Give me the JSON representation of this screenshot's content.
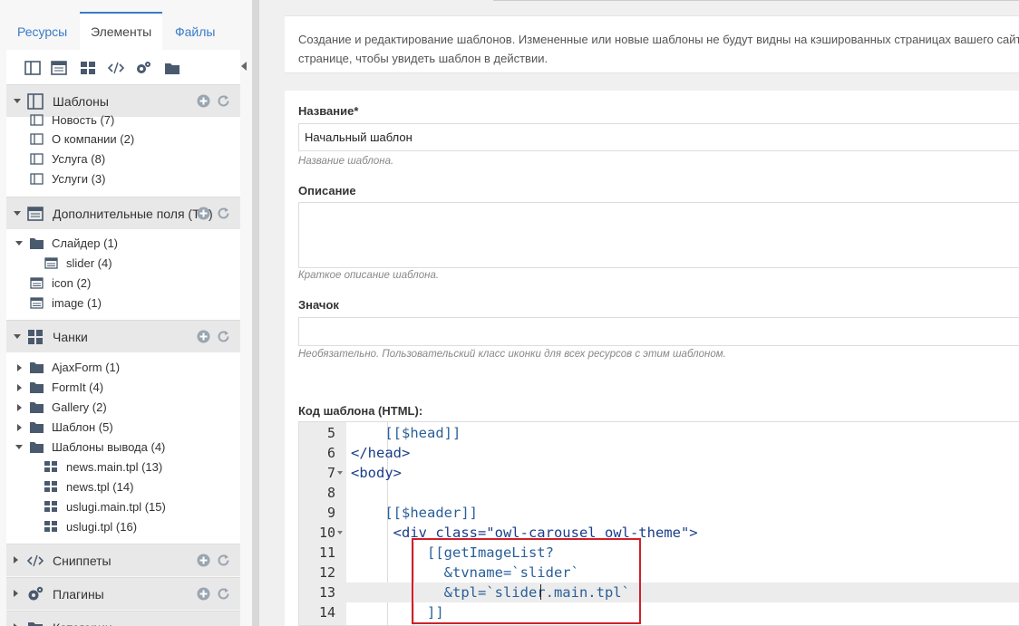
{
  "left_panel": {
    "tabs": [
      {
        "label": "Ресурсы",
        "active": false
      },
      {
        "label": "Элементы",
        "active": true
      },
      {
        "label": "Файлы",
        "active": false
      }
    ],
    "toolbar_icons": [
      "templates-icon",
      "tvs-icon",
      "chunks-icon",
      "snippets-icon",
      "plugins-icon",
      "categories-icon"
    ],
    "sections": {
      "templates": {
        "title": "Шаблоны"
      },
      "tvs": {
        "title": "Дополнительные поля (TV)"
      },
      "chunks": {
        "title": "Чанки"
      },
      "snippets": {
        "title": "Сниппеты"
      },
      "plugins": {
        "title": "Плагины"
      },
      "categories": {
        "title": "Категории"
      }
    },
    "template_items": [
      {
        "label": "Новость (7)"
      },
      {
        "label": "О компании (2)"
      },
      {
        "label": "Услуга (8)"
      },
      {
        "label": "Услуги (3)"
      }
    ],
    "tv_items": [
      {
        "label": "Слайдер (1)"
      },
      {
        "label": "slider (4)"
      },
      {
        "label": "icon (2)"
      },
      {
        "label": "image (1)"
      }
    ],
    "chunk_items": [
      {
        "label": "AjaxForm (1)"
      },
      {
        "label": "FormIt (4)"
      },
      {
        "label": "Gallery (2)"
      },
      {
        "label": "Шаблон (5)"
      },
      {
        "label": "Шаблоны вывода (4)"
      },
      {
        "label": "news.main.tpl (13)"
      },
      {
        "label": "news.tpl (14)"
      },
      {
        "label": "uslugi.main.tpl (15)"
      },
      {
        "label": "uslugi.tpl (16)"
      }
    ]
  },
  "main": {
    "info_text": "Создание и редактирование шаблонов. Измененные или новые шаблоны не будут видны на кэшированных страницах вашего сайт\nстранице, чтобы увидеть шаблон в действии.",
    "name_label": "Название*",
    "name_value": "Начальный шаблон",
    "name_hint": "Название шаблона.",
    "desc_label": "Описание",
    "desc_hint": "Краткое описание шаблона.",
    "icon_label": "Значок",
    "icon_hint": "Необязательно. Пользовательский класс иконки для всех ресурсов с этим шаблоном.",
    "code_label": "Код шаблона (HTML):"
  },
  "editor": {
    "lines": [
      {
        "num": "5",
        "code": "    [[$head]]"
      },
      {
        "num": "6",
        "code": "</head>"
      },
      {
        "num": "7",
        "code": "<body>"
      },
      {
        "num": "8",
        "code": ""
      },
      {
        "num": "9",
        "code": "    [[$header]]"
      },
      {
        "num": "10",
        "code": "     <div class=\"owl-carousel owl-theme\">"
      },
      {
        "num": "11",
        "code": "         [[getImageList?"
      },
      {
        "num": "12",
        "code": "           &tvname=`slider`"
      },
      {
        "num": "13",
        "code": "           &tpl=`slider.main.tpl`"
      },
      {
        "num": "14",
        "code": "         ]]"
      }
    ],
    "highlighted_line": "13"
  },
  "colors": {
    "accent": "#3a7bc8",
    "folder": "#4a5a6e",
    "annotation_box": "#d0202a"
  }
}
